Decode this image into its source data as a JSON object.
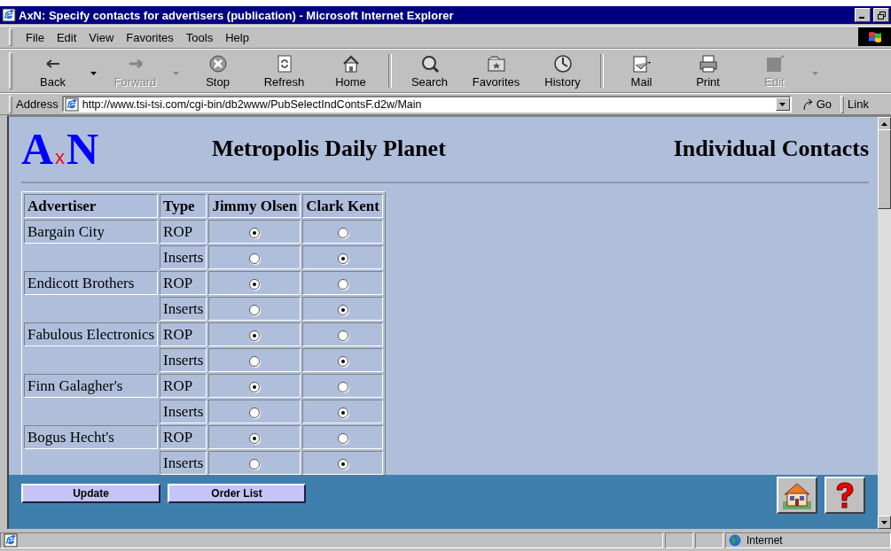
{
  "window": {
    "title": "AxN: Specify contacts for advertisers (publication) - Microsoft Internet Explorer"
  },
  "menu": [
    "File",
    "Edit",
    "View",
    "Favorites",
    "Tools",
    "Help"
  ],
  "toolbar": [
    [
      {
        "label": "Back",
        "disabled": false,
        "dropdown": true
      },
      {
        "label": "Forward",
        "disabled": true,
        "dropdown": true
      },
      {
        "label": "Stop",
        "disabled": false,
        "dropdown": false
      },
      {
        "label": "Refresh",
        "disabled": false,
        "dropdown": false
      },
      {
        "label": "Home",
        "disabled": false,
        "dropdown": false
      }
    ],
    [
      {
        "label": "Search",
        "disabled": false,
        "dropdown": false
      },
      {
        "label": "Favorites",
        "disabled": false,
        "dropdown": false
      },
      {
        "label": "History",
        "disabled": false,
        "dropdown": false
      }
    ],
    [
      {
        "label": "Mail",
        "disabled": false,
        "dropdown": false
      },
      {
        "label": "Print",
        "disabled": false,
        "dropdown": false
      },
      {
        "label": "Edit",
        "disabled": true,
        "dropdown": true
      }
    ]
  ],
  "address": {
    "label": "Address",
    "url": "http://www.tsi-tsi.com/cgi-bin/db2www/PubSelectIndContsF.d2w/Main",
    "go": "Go",
    "links": "Link"
  },
  "page": {
    "logo": {
      "left": "A",
      "middle": "x",
      "right": "N"
    },
    "publication": "Metropolis Daily Planet",
    "heading": "Individual Contacts",
    "table": {
      "columns": [
        "Advertiser",
        "Type",
        "Jimmy Olsen",
        "Clark Kent"
      ],
      "rows": [
        {
          "advertiser": "Bargain City",
          "type": "ROP",
          "choices": [
            {
              "selected": true
            },
            {
              "selected": false
            }
          ]
        },
        {
          "type": "Inserts",
          "choices": [
            {
              "selected": false
            },
            {
              "selected": true
            }
          ]
        },
        {
          "advertiser": "Endicott Brothers",
          "type": "ROP",
          "choices": [
            {
              "selected": true
            },
            {
              "selected": false
            }
          ]
        },
        {
          "type": "Inserts",
          "choices": [
            {
              "selected": false
            },
            {
              "selected": true
            }
          ]
        },
        {
          "advertiser": "Fabulous Electronics",
          "type": "ROP",
          "choices": [
            {
              "selected": true
            },
            {
              "selected": false
            }
          ]
        },
        {
          "type": "Inserts",
          "choices": [
            {
              "selected": false
            },
            {
              "selected": true
            }
          ]
        },
        {
          "advertiser": "Finn Galagher's",
          "type": "ROP",
          "choices": [
            {
              "selected": true
            },
            {
              "selected": false
            }
          ]
        },
        {
          "type": "Inserts",
          "choices": [
            {
              "selected": false
            },
            {
              "selected": true
            }
          ]
        },
        {
          "advertiser": "Bogus Hecht's",
          "type": "ROP",
          "choices": [
            {
              "selected": true
            },
            {
              "selected": false
            }
          ]
        },
        {
          "type": "Inserts",
          "choices": [
            {
              "selected": false
            },
            {
              "selected": true
            }
          ]
        }
      ]
    },
    "buttons": [
      "Update",
      "Order List"
    ]
  },
  "status_bar": {
    "zone": "Internet"
  }
}
